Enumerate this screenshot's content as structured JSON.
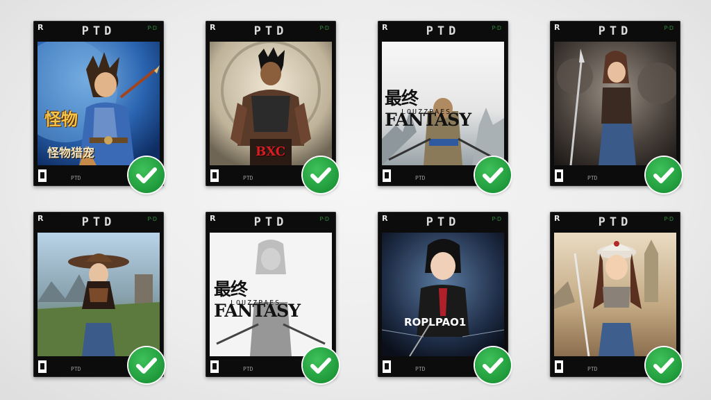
{
  "background": "#ececec",
  "case_brand": "PTD",
  "case_subbrand": "P·D",
  "check_color": "#22a33f",
  "cases": [
    {
      "id": "monster-hunter",
      "title_main": "怪物",
      "title_sub": "怪物猎宠",
      "accent": "#1f63b5"
    },
    {
      "id": "warrior",
      "title_main": "BXC",
      "accent": "#b3171b"
    },
    {
      "id": "fantasy-1",
      "title_main": "最终FANTASY",
      "title_sub": "LOUZZPAES",
      "accent": "#f2f2f2"
    },
    {
      "id": "spear-girl",
      "accent": "#4a3a30"
    },
    {
      "id": "cowboy-girl",
      "accent": "#6b8f4a"
    },
    {
      "id": "fantasy-2",
      "title_main": "最终FANTASY",
      "title_sub": "LOUZZPAES",
      "accent": "#f5f5f5"
    },
    {
      "id": "dark-boy",
      "title_main": "ROPLPAO1",
      "accent": "#1a2a44"
    },
    {
      "id": "baseball-girl",
      "accent": "#c9a87a"
    }
  ]
}
